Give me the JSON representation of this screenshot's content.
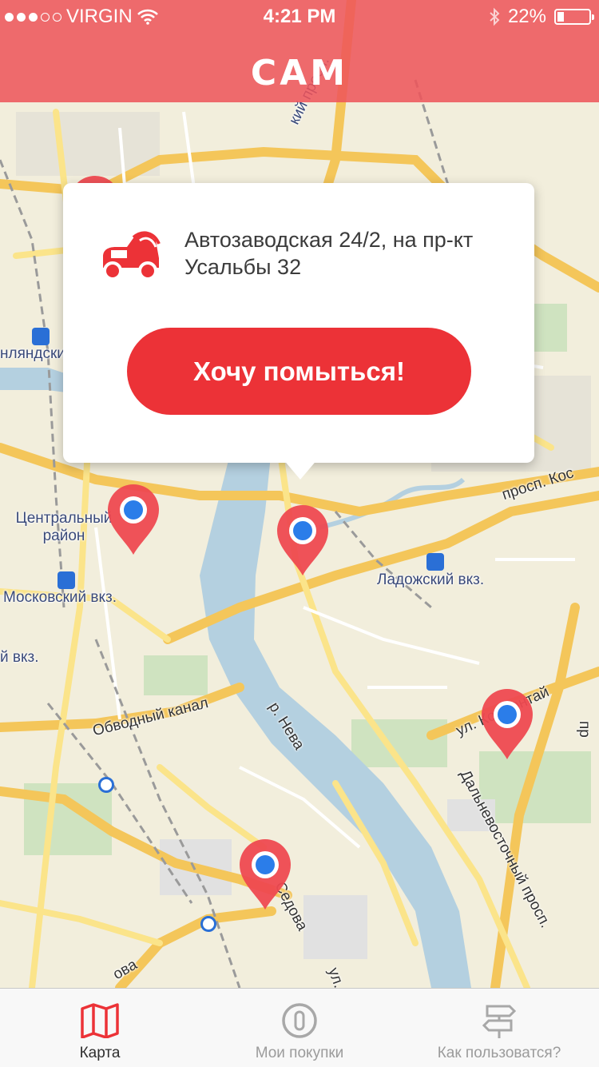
{
  "status_bar": {
    "carrier": "VIRGIN",
    "time": "4:21 PM",
    "battery": "22%",
    "battery_level": 0.22,
    "signal_bars_filled": 3,
    "signal_bars_total": 5,
    "icons": [
      "wifi-icon",
      "bluetooth-icon",
      "battery-icon"
    ]
  },
  "header": {
    "logo": "CAM",
    "color": "#ee545a"
  },
  "popup": {
    "address": "Автозаводская 24/2, на пр-кт Усальбы 32",
    "action_label": "Хочу помыться!",
    "icon": "car-wash-icon",
    "accent": "#ec3237"
  },
  "map": {
    "labels": {
      "central_district": "Центральный район",
      "moskovsky": "Московский вкз.",
      "finlyandsky": "нляндски",
      "vkz_fragment": "й вкз.",
      "ladozhsky": "Ладожский вкз.",
      "obvodny": "Обводный канал",
      "neva": "р. Нева",
      "prosp_kos": "просп. Кос",
      "kollontai": "ул. Коллонтай",
      "dalnevost": "Дальневосточный просп.",
      "sedova": "Седова",
      "prosp_top": "кий просп.",
      "ul_fragment": "ул.",
      "pr_fragment": "пр",
      "bottom_street": "ова"
    },
    "markers": [
      "map-pin",
      "map-pin",
      "map-pin",
      "map-pin",
      "map-pin"
    ]
  },
  "tabbar": {
    "tabs": [
      {
        "label": "Карта",
        "icon": "map-icon",
        "active": true
      },
      {
        "label": "Мои покупки",
        "icon": "coin-icon",
        "active": false
      },
      {
        "label": "Как пользоватся?",
        "icon": "signpost-icon",
        "active": false
      }
    ]
  }
}
